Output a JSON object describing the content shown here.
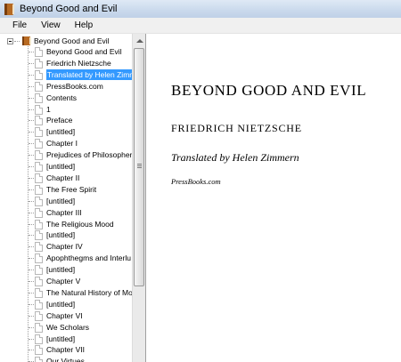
{
  "window": {
    "title": "Beyond Good and Evil",
    "icon": "book-icon"
  },
  "menu": {
    "items": [
      "File",
      "View",
      "Help"
    ]
  },
  "tree": {
    "root_label": "Beyond Good and Evil",
    "root_icon": "book-icon",
    "selected_index": 2,
    "items": [
      "Beyond Good and Evil",
      "Friedrich Nietzsche",
      "Translated by Helen Zimm",
      "PressBooks.com",
      "Contents",
      "1",
      "Preface",
      "[untitled]",
      "Chapter I",
      "Prejudices of Philosopher",
      "[untitled]",
      "Chapter II",
      "The Free Spirit",
      "[untitled]",
      "Chapter III",
      "The Religious Mood",
      "[untitled]",
      "Chapter IV",
      "Apophthegms and Interlu",
      "[untitled]",
      "Chapter V",
      "The Natural History of Mo",
      "[untitled]",
      "Chapter VI",
      "We Scholars",
      "[untitled]",
      "Chapter VII",
      "Our Virtues"
    ],
    "selection_color": "#3399ff"
  },
  "content": {
    "title": "BEYOND GOOD AND EVIL",
    "author": "FRIEDRICH NIETZSCHE",
    "translator": "Translated by Helen Zimmern",
    "publisher": "PressBooks.com"
  }
}
